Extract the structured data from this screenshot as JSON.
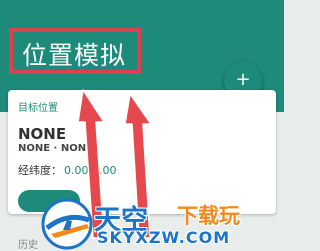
{
  "header": {
    "title": "位置模拟",
    "add_icon": "plus-icon",
    "bg_color": "#1e8a7a",
    "highlight_color": "#d9434f"
  },
  "card": {
    "label": "目标位置",
    "name": "NONE",
    "subtitle": "NONE · NONE",
    "lat_label": "经纬度：",
    "lat_value": "0.00,0.00"
  },
  "history": {
    "label": "历史"
  },
  "annotation": {
    "arrow_color": "#e5484d",
    "arrow_count": 2
  },
  "watermark": {
    "title": "天空",
    "slogan": "下载玩",
    "domain": "SKYXZW.COM",
    "logo_icon": "plane-globe-logo-icon"
  }
}
